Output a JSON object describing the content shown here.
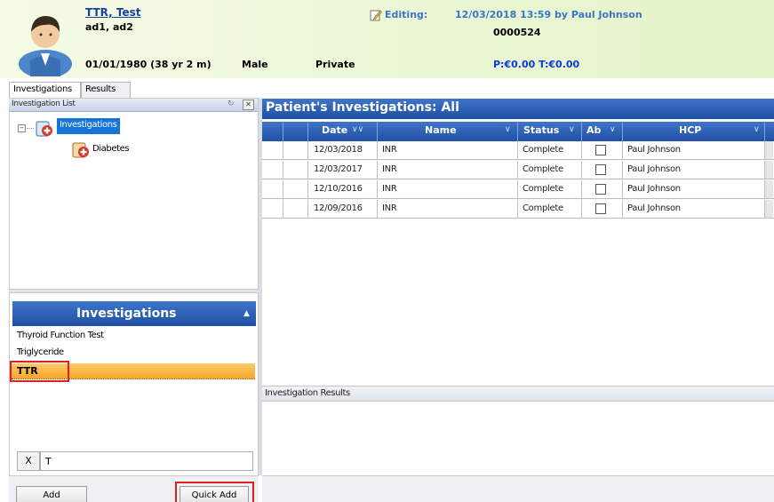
{
  "header": {
    "patient_name": "TTR, Test",
    "address": "ad1, ad2",
    "dob_age": "01/01/1980 (38 yr 2 m)",
    "gender": "Male",
    "category": "Private",
    "editing_label": "Editing:",
    "editing_info": "12/03/2018 13:59 by Paul Johnson",
    "patient_id": "0000524",
    "balance": "P:€0.00 T:€0.00"
  },
  "tabs": [
    {
      "label": "Investigations",
      "active": true
    },
    {
      "label": "Results",
      "active": false
    }
  ],
  "investigation_list": {
    "title": "Investigation List",
    "tree": {
      "expander": "⊟",
      "root": "Investigations",
      "child": "Diabetes"
    }
  },
  "investigations_panel": {
    "title": "Investigations",
    "items": [
      "Thyroid Function Test",
      "Triglyceride",
      "TTR"
    ],
    "selected": "TTR",
    "clear_label": "X",
    "search_value": "T"
  },
  "buttons": {
    "add": "Add",
    "quick_add": "Quick Add"
  },
  "right_panel": {
    "title": "Patient's Investigations: All",
    "columns": [
      "Date",
      "Name",
      "Status",
      "Ab",
      "HCP"
    ],
    "rows": [
      {
        "date": "12/03/2018",
        "name": "INR",
        "status": "Complete",
        "ab": false,
        "hcp": "Paul Johnson"
      },
      {
        "date": "12/03/2017",
        "name": "INR",
        "status": "Complete",
        "ab": false,
        "hcp": "Paul Johnson"
      },
      {
        "date": "12/10/2016",
        "name": "INR",
        "status": "Complete",
        "ab": false,
        "hcp": "Paul Johnson"
      },
      {
        "date": "12/09/2016",
        "name": "INR",
        "status": "Complete",
        "ab": false,
        "hcp": "Paul Johnson"
      }
    ],
    "results_title": "Investigation Results"
  },
  "colors": {
    "accent_blue": "#1f4fa3",
    "highlight_red": "#e02020",
    "selection_orange": "#f7a629"
  }
}
